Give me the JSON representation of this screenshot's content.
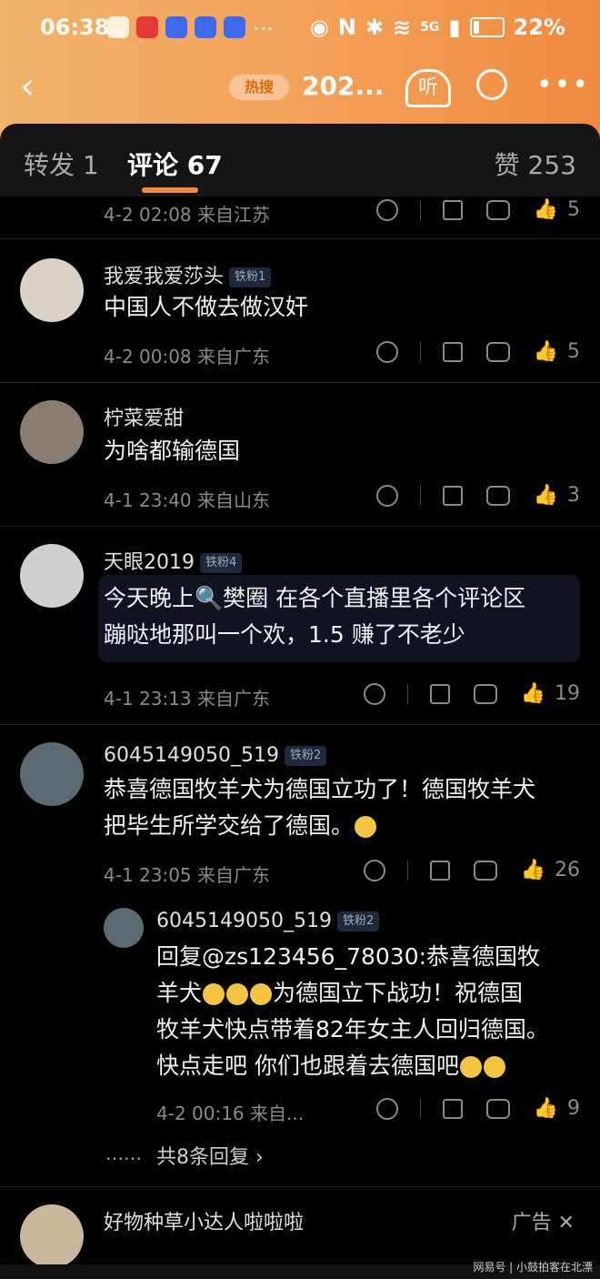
{
  "status": {
    "time": "06:38",
    "network": "5G",
    "battery": "22%",
    "battery_level": 0.22
  },
  "nav": {
    "hot_tag": "热搜",
    "title": "202...",
    "listen": "听"
  },
  "tabs": {
    "repost": "转发 1",
    "comment": "评论 67",
    "likes": "赞 253"
  },
  "top_partial": {
    "meta": "4-2 02:08  来自江苏",
    "likes": "5"
  },
  "comments": [
    {
      "name": "我爱我爱莎头",
      "badge": "铁粉1",
      "text": "中国人不做去做汉奸",
      "meta": "4-2 00:08  来自广东",
      "likes": "5"
    },
    {
      "name": "柠菜爱甜",
      "badge": "",
      "text": "为啥都输德国",
      "meta": "4-1 23:40  来自山东",
      "likes": "3"
    },
    {
      "name": "天眼2019",
      "badge": "铁粉4",
      "text_line1": "今天晚上🔍樊圈 在各个直播里各个评论区",
      "text_line2": "蹦哒地那叫一个欢，1.5 赚了不老少",
      "meta": "4-1 23:13  来自广东",
      "likes": "19"
    },
    {
      "name": "6045149050_519",
      "badge": "铁粉2",
      "text_line1": "恭喜德国牧羊犬为德国立功了！德国牧羊犬",
      "text_line2": "把毕生所学交给了德国。",
      "meta": "4-1 23:05  来自广东",
      "likes": "26"
    }
  ],
  "reply": {
    "name": "6045149050_519",
    "badge": "铁粉2",
    "line1": "回复@zs123456_78030:恭喜德国牧",
    "line2": "羊犬",
    "line2b": "为德国立下战功！祝德国",
    "line3": "牧羊犬快点带着82年女主人回归德国。",
    "line4": "快点走吧 你们也跟着去德国吧",
    "meta": "4-2 00:16  来自...",
    "likes": "9",
    "more_replies": "共8条回复 ›",
    "dots": "……"
  },
  "ad": {
    "name": "好物种草小达人啦啦啦",
    "label": "广告 ✕"
  },
  "watermark": "网易号 | 小鼓拍客在北漂"
}
